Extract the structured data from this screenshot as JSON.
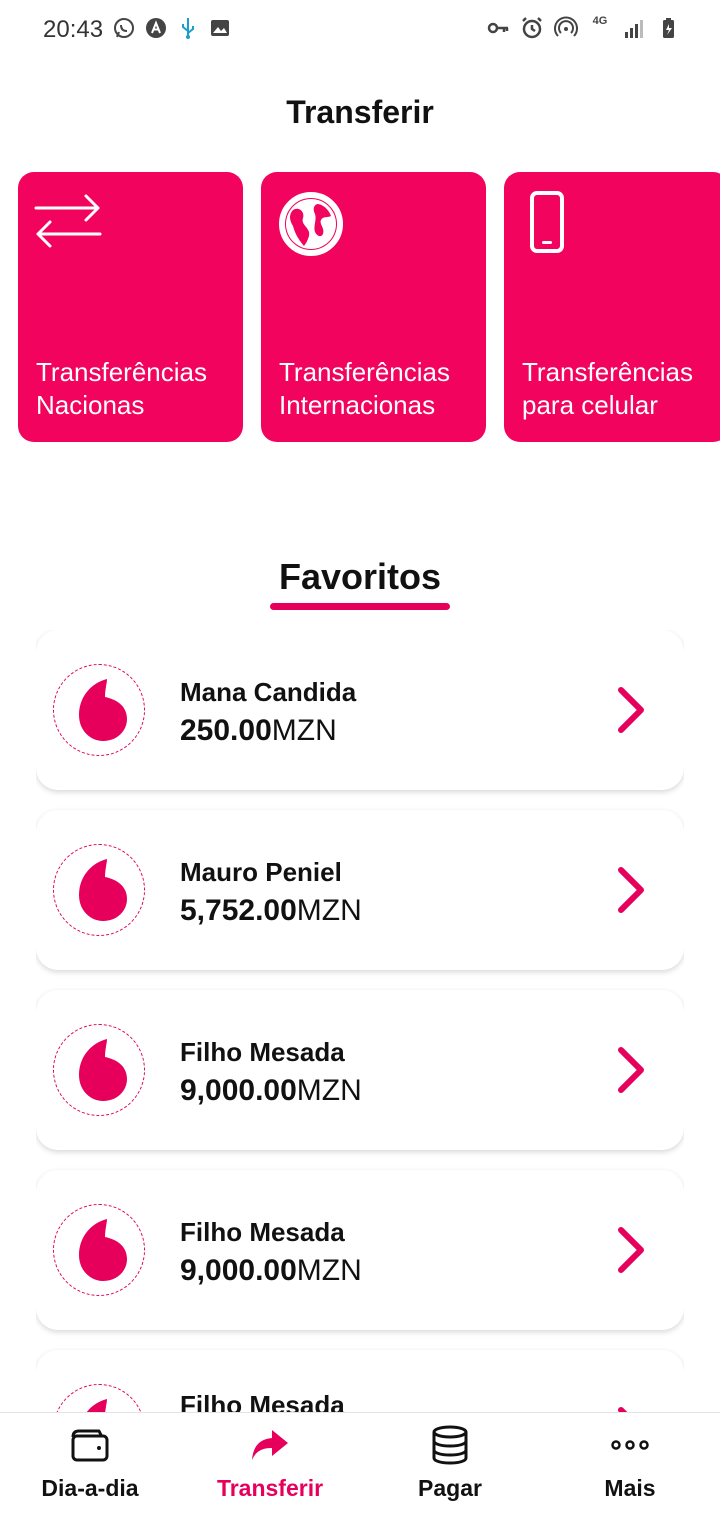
{
  "status_bar": {
    "time": "20:43",
    "left_icons": [
      "whatsapp-icon",
      "app-a-icon",
      "usb-icon",
      "image-icon"
    ],
    "right_icons": [
      "key-icon",
      "alarm-icon",
      "hotspot-icon",
      "4g-icon",
      "signal-icon",
      "battery-icon"
    ],
    "network_label": "4G"
  },
  "header": {
    "title": "Transferir"
  },
  "transfer_cards": [
    {
      "label": "Transferências\nNacionas",
      "icon": "transfer-arrows-icon"
    },
    {
      "label": "Transferências\nInternacionas",
      "icon": "globe-icon"
    },
    {
      "label": "Transferências\npara celular",
      "icon": "phone-icon"
    }
  ],
  "favorites": {
    "title": "Favoritos",
    "items": [
      {
        "name": "Mana Candida",
        "amount": "250.00",
        "currency": "MZN"
      },
      {
        "name": "Mauro Peniel",
        "amount": "5,752.00",
        "currency": "MZN"
      },
      {
        "name": "Filho Mesada",
        "amount": "9,000.00",
        "currency": "MZN"
      },
      {
        "name": "Filho Mesada",
        "amount": "9,000.00",
        "currency": "MZN"
      },
      {
        "name": "Filho Mesada",
        "amount": "",
        "currency": ""
      }
    ]
  },
  "bottom_nav": {
    "items": [
      {
        "label": "Dia-a-dia",
        "icon": "wallet-icon"
      },
      {
        "label": "Transferir",
        "icon": "share-arrow-icon",
        "active": true
      },
      {
        "label": "Pagar",
        "icon": "coins-icon"
      },
      {
        "label": "Mais",
        "icon": "more-dots-icon"
      }
    ]
  },
  "colors": {
    "accent": "#e6005c",
    "card": "#f2035e"
  }
}
